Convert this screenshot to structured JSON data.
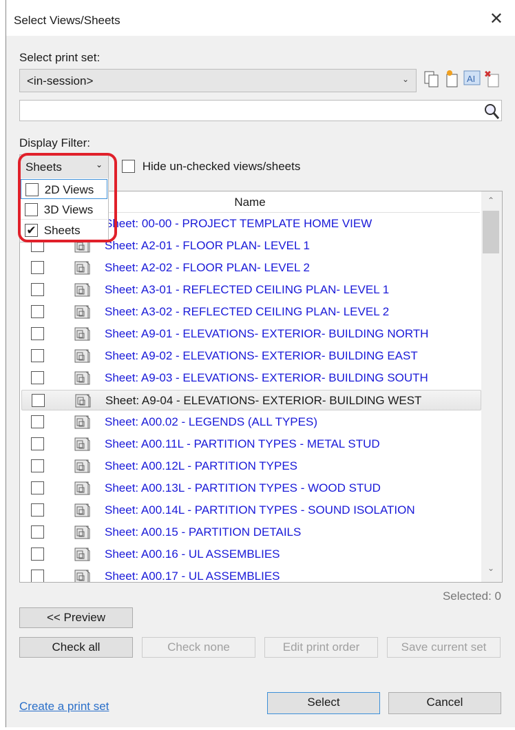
{
  "window": {
    "title": "Select Views/Sheets"
  },
  "print_set": {
    "label": "Select print set:",
    "value": "<in-session>"
  },
  "search": {
    "value": "",
    "placeholder": ""
  },
  "filter": {
    "label": "Display Filter:",
    "value": "Sheets",
    "options": [
      {
        "label": "2D Views",
        "checked": false
      },
      {
        "label": "3D Views",
        "checked": false
      },
      {
        "label": "Sheets",
        "checked": true
      }
    ],
    "hide_unchecked_label": "Hide un-checked views/sheets"
  },
  "list": {
    "header": "Name",
    "rows": [
      {
        "name": "Sheet: 00-00 - PROJECT TEMPLATE HOME VIEW"
      },
      {
        "name": "Sheet: A2-01 - FLOOR PLAN- LEVEL 1"
      },
      {
        "name": "Sheet: A2-02 - FLOOR PLAN- LEVEL 2"
      },
      {
        "name": "Sheet: A3-01 - REFLECTED CEILING PLAN- LEVEL 1"
      },
      {
        "name": "Sheet: A3-02 - REFLECTED CEILING PLAN- LEVEL 2"
      },
      {
        "name": "Sheet: A9-01 - ELEVATIONS- EXTERIOR- BUILDING NORTH"
      },
      {
        "name": "Sheet: A9-02 - ELEVATIONS- EXTERIOR- BUILDING EAST"
      },
      {
        "name": "Sheet: A9-03 - ELEVATIONS- EXTERIOR- BUILDING SOUTH"
      },
      {
        "name": "Sheet: A9-04 - ELEVATIONS- EXTERIOR- BUILDING WEST",
        "highlighted": true
      },
      {
        "name": "Sheet: A00.02 - LEGENDS (ALL TYPES)"
      },
      {
        "name": "Sheet: A00.11L - PARTITION TYPES - METAL STUD"
      },
      {
        "name": "Sheet: A00.12L - PARTITION TYPES"
      },
      {
        "name": "Sheet: A00.13L - PARTITION TYPES - WOOD STUD"
      },
      {
        "name": "Sheet: A00.14L - PARTITION TYPES - SOUND ISOLATION"
      },
      {
        "name": "Sheet: A00.15 - PARTITION DETAILS"
      },
      {
        "name": "Sheet: A00.16 - UL ASSEMBLIES"
      },
      {
        "name": "Sheet: A00.17 - UL ASSEMBLIES"
      }
    ]
  },
  "selected_count": "Selected: 0",
  "buttons": {
    "preview": "<< Preview",
    "check_all": "Check all",
    "check_none": "Check none",
    "edit_print_order": "Edit print order",
    "save_current_set": "Save current set",
    "select": "Select",
    "cancel": "Cancel"
  },
  "create_link": "Create a print set",
  "colors": {
    "link": "#1a1ad8",
    "highlight_box": "#e0202a"
  }
}
